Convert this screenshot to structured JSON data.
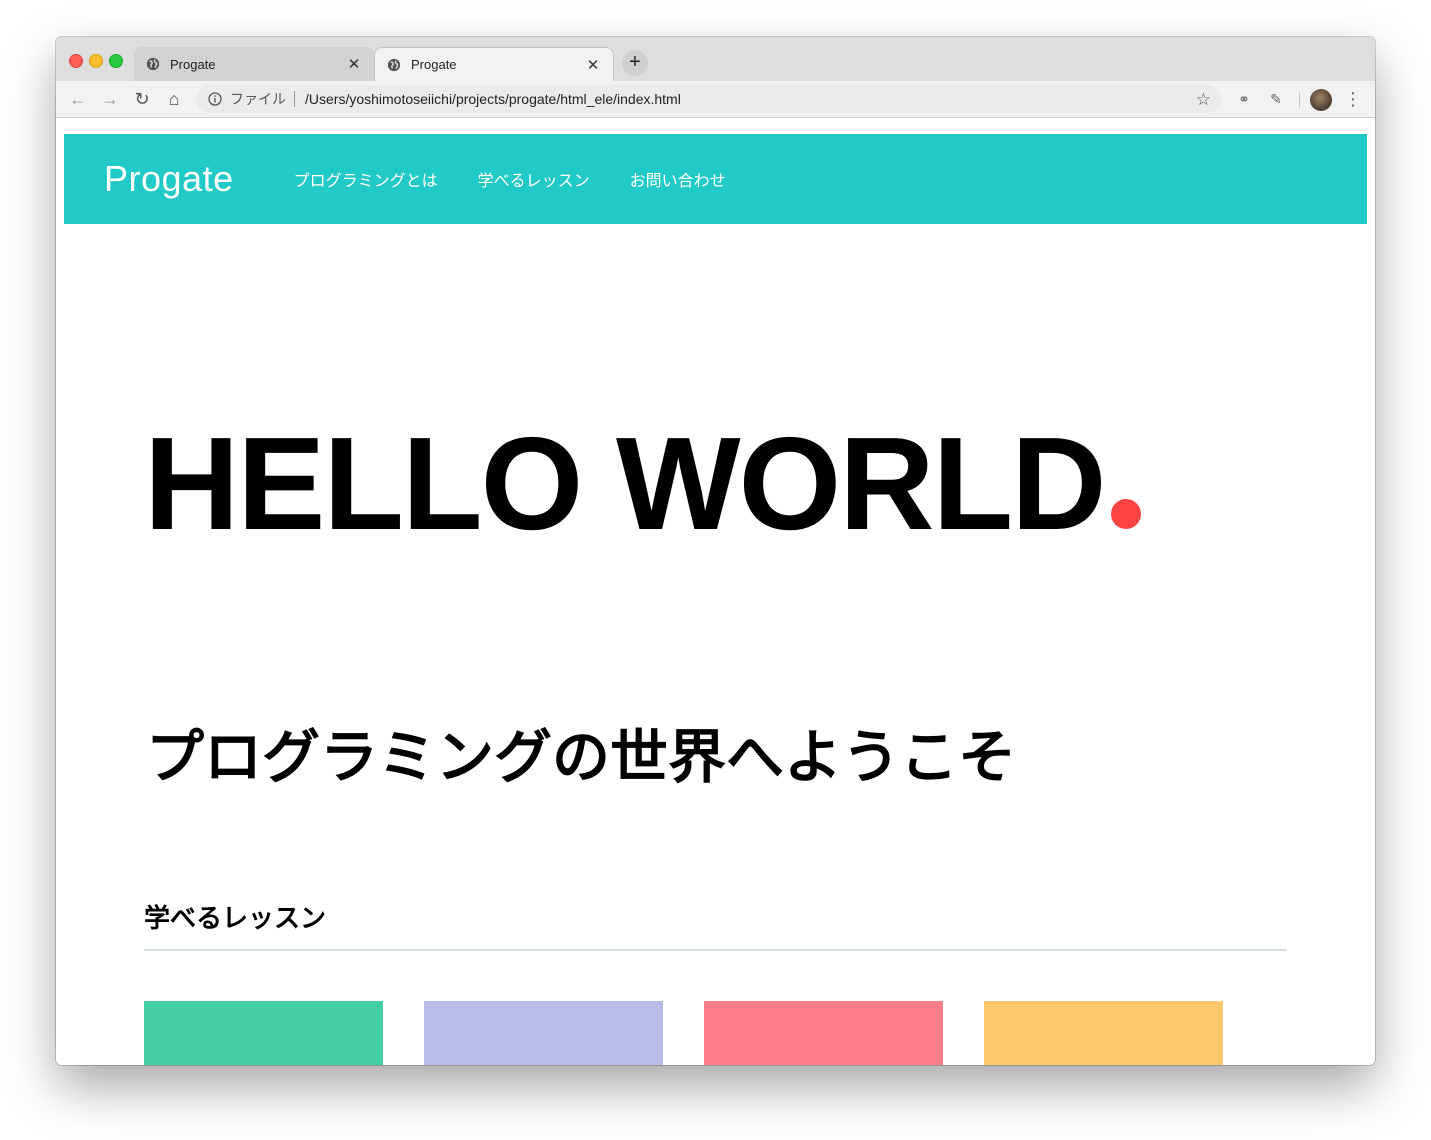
{
  "browser": {
    "tabs": [
      {
        "title": "Progate"
      },
      {
        "title": "Progate"
      }
    ],
    "new_tab_label": "+",
    "omnibox": {
      "scheme_label": "ファイル",
      "url": "/Users/yoshimotoseiichi/projects/progate/html_ele/index.html"
    }
  },
  "site": {
    "logo": "Progate",
    "nav": [
      {
        "label": "プログラミングとは"
      },
      {
        "label": "学べるレッスン"
      },
      {
        "label": "お問い合わせ"
      }
    ],
    "hero_title": "HELLO WORLD",
    "subtitle": "プログラミングの世界へようこそ",
    "section_title": "学べるレッスン",
    "lesson_cards": [
      {
        "color": "#45cda3"
      },
      {
        "color": "#b8bce8"
      },
      {
        "color": "#fe7f8b"
      },
      {
        "color": "#fdc86d"
      }
    ],
    "colors": {
      "header": "#21cac6",
      "accent_dot": "#fc4444"
    }
  }
}
